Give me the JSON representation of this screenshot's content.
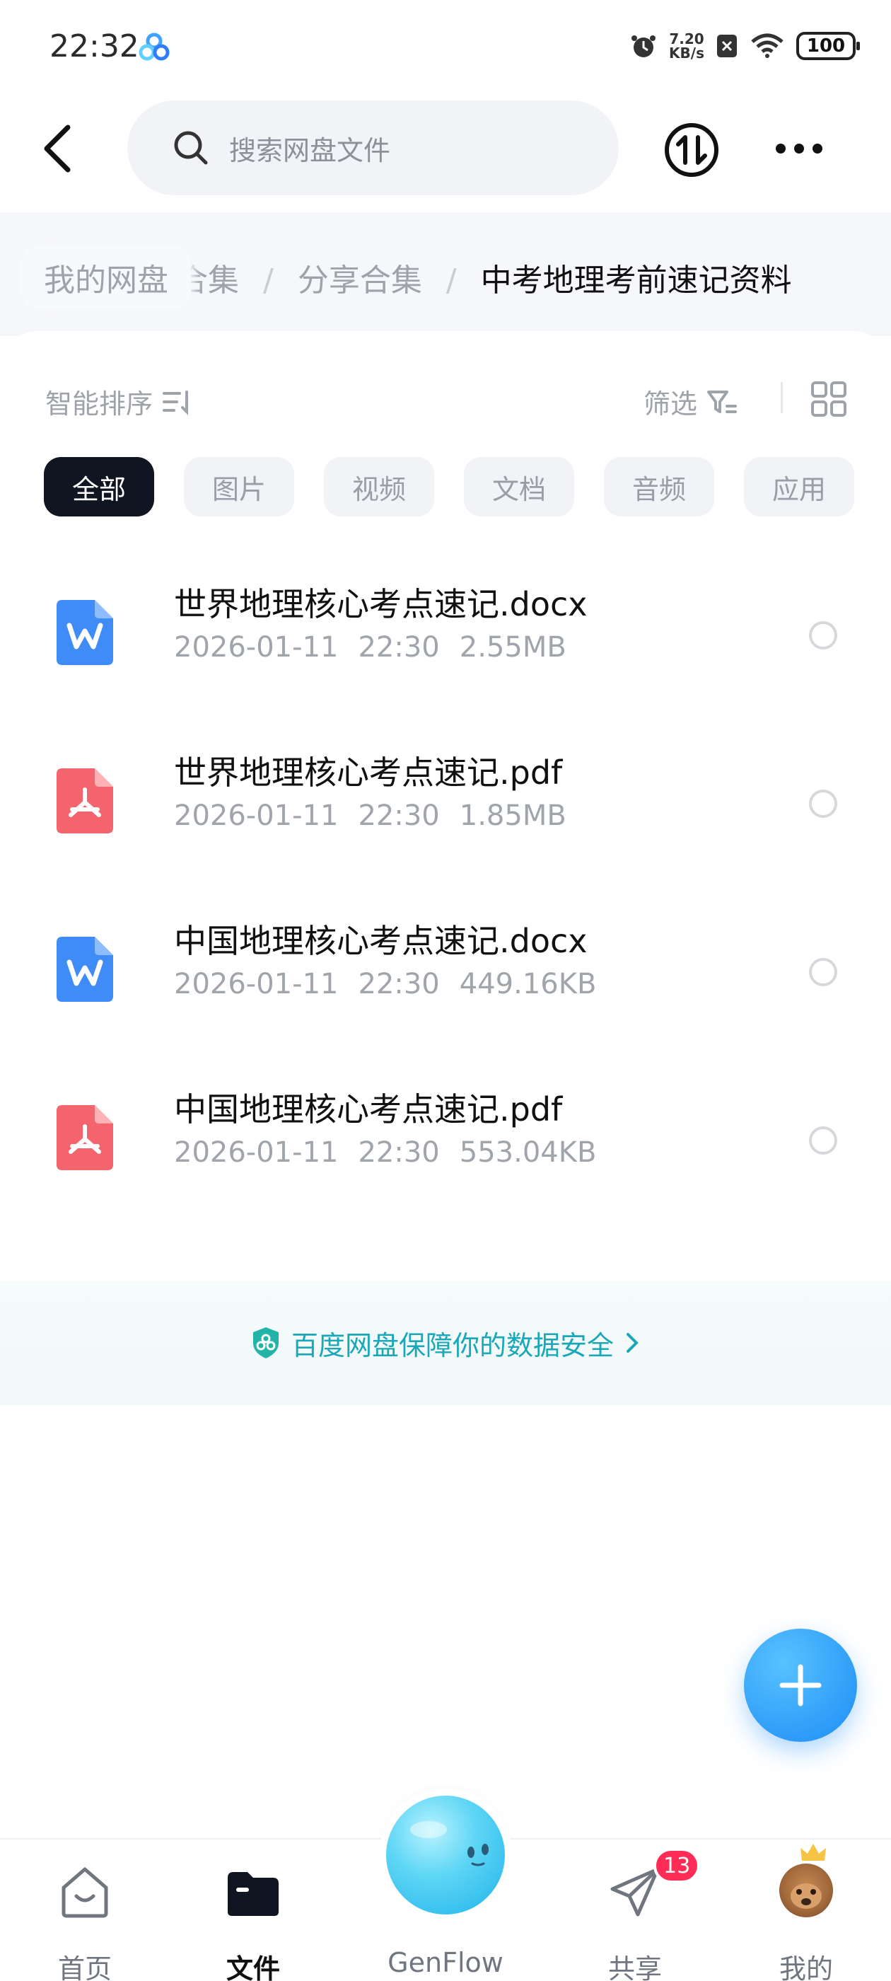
{
  "status_bar": {
    "time": "22:32",
    "speed_value": "7.20",
    "speed_unit": "KB/s",
    "battery": "100"
  },
  "header": {
    "search_placeholder": "搜索网盘文件",
    "icons": {
      "back": "back-arrow-icon",
      "search": "search-icon",
      "transfer": "transfer-icon",
      "more": "more-icon"
    }
  },
  "breadcrumb": {
    "root": "我的网盘",
    "items": [
      "资料合集",
      "分享合集",
      "中考地理考前速记资料"
    ],
    "partial_first": "合集",
    "separator": "/"
  },
  "toolbar": {
    "sort_label": "智能排序",
    "filter_label": "筛选"
  },
  "chips": [
    "全部",
    "图片",
    "视频",
    "文档",
    "音频",
    "应用"
  ],
  "files": [
    {
      "name": "世界地理核心考点速记.docx",
      "date": "2026-01-11",
      "time": "22:30",
      "size": "2.55MB",
      "type": "word"
    },
    {
      "name": "世界地理核心考点速记.pdf",
      "date": "2026-01-11",
      "time": "22:30",
      "size": "1.85MB",
      "type": "pdf"
    },
    {
      "name": "中国地理核心考点速记.docx",
      "date": "2026-01-11",
      "time": "22:30",
      "size": "449.16KB",
      "type": "word"
    },
    {
      "name": "中国地理核心考点速记.pdf",
      "date": "2026-01-11",
      "time": "22:30",
      "size": "553.04KB",
      "type": "pdf"
    }
  ],
  "security_banner": "百度网盘保障你的数据安全",
  "bottom_nav": {
    "home": "首页",
    "files": "文件",
    "genflow": "GenFlow",
    "share": "共享",
    "share_badge": "13",
    "me": "我的"
  },
  "colors": {
    "accent": "#1d8cf5",
    "security_text": "#1aa7b7",
    "word_icon": "#3f8cf6",
    "pdf_icon": "#f4646d",
    "badge": "#ff2d55"
  }
}
